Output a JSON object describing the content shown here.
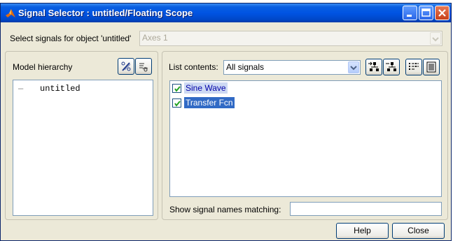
{
  "window": {
    "title": "Signal Selector : untitled/Floating Scope",
    "controls": [
      "minimize-icon",
      "maximize-icon",
      "close-icon"
    ]
  },
  "object_select": {
    "label": "Select signals for object 'untitled'",
    "value": "Axes 1"
  },
  "hierarchy": {
    "label": "Model hierarchy",
    "tree": [
      {
        "prefix": "—",
        "name": "untitled"
      }
    ],
    "buttons": [
      "show-library-links-icon",
      "show-masked-subsystems-icon"
    ]
  },
  "list": {
    "contents_label": "List contents:",
    "contents_value": "All signals",
    "tool_buttons": [
      "expand-hierarchy-icon",
      "collapse-hierarchy-icon",
      "list-view-icon",
      "details-view-icon"
    ],
    "signals": [
      {
        "name": "Sine Wave",
        "checked": true,
        "selected": "light"
      },
      {
        "name": "Transfer Fcn",
        "checked": true,
        "selected": "dark"
      }
    ],
    "filter_label": "Show signal names matching:",
    "filter_value": ""
  },
  "buttons": {
    "help": "Help",
    "close": "Close"
  },
  "colors": {
    "titlebar": "#0054e3",
    "dialog_bg": "#ece9d8",
    "selection": "#316ac5"
  }
}
